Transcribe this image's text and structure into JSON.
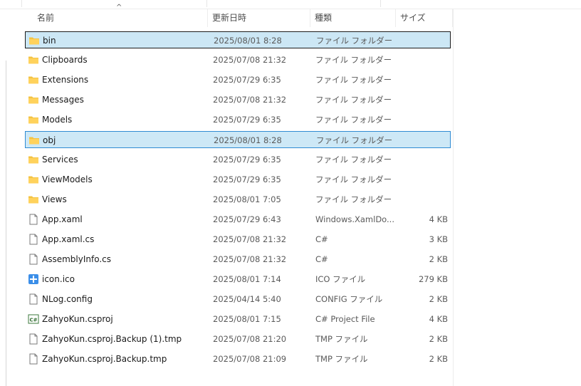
{
  "header": {
    "name": "名前",
    "date": "更新日時",
    "type": "種類",
    "size": "サイズ",
    "sort_indicator": "^"
  },
  "colors": {
    "selection_bg": "#cde8f6",
    "selection_border": "#2f8bd3",
    "folder": "#f4c342"
  },
  "files": [
    {
      "name": "bin",
      "date": "2025/08/01 8:28",
      "type": "ファイル フォルダー",
      "size": "",
      "icon": "folder-icon",
      "selected": true,
      "focused": true
    },
    {
      "name": "Clipboards",
      "date": "2025/07/08 21:32",
      "type": "ファイル フォルダー",
      "size": "",
      "icon": "folder-icon"
    },
    {
      "name": "Extensions",
      "date": "2025/07/29 6:35",
      "type": "ファイル フォルダー",
      "size": "",
      "icon": "folder-icon"
    },
    {
      "name": "Messages",
      "date": "2025/07/08 21:32",
      "type": "ファイル フォルダー",
      "size": "",
      "icon": "folder-icon"
    },
    {
      "name": "Models",
      "date": "2025/07/29 6:35",
      "type": "ファイル フォルダー",
      "size": "",
      "icon": "folder-icon"
    },
    {
      "name": "obj",
      "date": "2025/08/01 8:28",
      "type": "ファイル フォルダー",
      "size": "",
      "icon": "folder-icon",
      "selected": true
    },
    {
      "name": "Services",
      "date": "2025/07/29 6:35",
      "type": "ファイル フォルダー",
      "size": "",
      "icon": "folder-icon"
    },
    {
      "name": "ViewModels",
      "date": "2025/07/29 6:35",
      "type": "ファイル フォルダー",
      "size": "",
      "icon": "folder-icon"
    },
    {
      "name": "Views",
      "date": "2025/08/01 7:05",
      "type": "ファイル フォルダー",
      "size": "",
      "icon": "folder-icon"
    },
    {
      "name": "App.xaml",
      "date": "2025/07/29 6:43",
      "type": "Windows.XamlDo...",
      "size": "4 KB",
      "icon": "file-icon"
    },
    {
      "name": "App.xaml.cs",
      "date": "2025/07/08 21:32",
      "type": "C#",
      "size": "3 KB",
      "icon": "file-icon"
    },
    {
      "name": "AssemblyInfo.cs",
      "date": "2025/07/08 21:32",
      "type": "C#",
      "size": "2 KB",
      "icon": "file-icon"
    },
    {
      "name": "icon.ico",
      "date": "2025/08/01 7:14",
      "type": "ICO ファイル",
      "size": "279 KB",
      "icon": "ico-icon"
    },
    {
      "name": "NLog.config",
      "date": "2025/04/14 5:40",
      "type": "CONFIG ファイル",
      "size": "2 KB",
      "icon": "file-icon"
    },
    {
      "name": "ZahyoKun.csproj",
      "date": "2025/08/01 7:15",
      "type": "C# Project File",
      "size": "4 KB",
      "icon": "csproj-icon"
    },
    {
      "name": "ZahyoKun.csproj.Backup (1).tmp",
      "date": "2025/07/08 21:20",
      "type": "TMP ファイル",
      "size": "2 KB",
      "icon": "file-icon"
    },
    {
      "name": "ZahyoKun.csproj.Backup.tmp",
      "date": "2025/07/08 21:09",
      "type": "TMP ファイル",
      "size": "2 KB",
      "icon": "file-icon"
    }
  ]
}
